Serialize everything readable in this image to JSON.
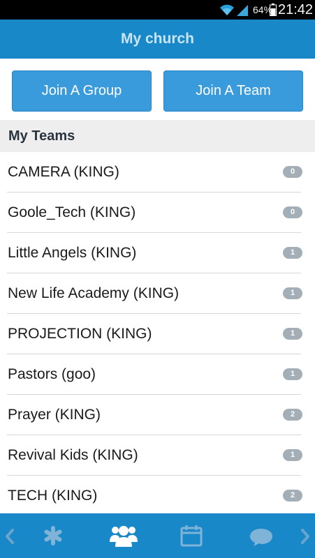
{
  "status_bar": {
    "battery": "64%",
    "time": "21:42",
    "icons": [
      "wifi-icon",
      "signal-icon",
      "battery-icon"
    ]
  },
  "header": {
    "title": "My church"
  },
  "actions": {
    "join_group": "Join A Group",
    "join_team": "Join A Team"
  },
  "section": {
    "title": "My Teams"
  },
  "teams": [
    {
      "name": "CAMERA (KING)",
      "count": "0"
    },
    {
      "name": "Goole_Tech (KING)",
      "count": "0"
    },
    {
      "name": "Little Angels (KING)",
      "count": "1"
    },
    {
      "name": "New Life Academy (KING)",
      "count": "1"
    },
    {
      "name": "PROJECTION (KING)",
      "count": "1"
    },
    {
      "name": "Pastors (goo)",
      "count": "1"
    },
    {
      "name": "Prayer (KING)",
      "count": "2"
    },
    {
      "name": "Revival Kids (KING)",
      "count": "1"
    },
    {
      "name": "TECH (KING)",
      "count": "2"
    }
  ],
  "bottom_nav": {
    "items": [
      "chevron-left-icon",
      "asterisk-icon",
      "people-icon",
      "calendar-icon",
      "chat-bubble-icon",
      "chevron-right-icon"
    ]
  },
  "colors": {
    "primary": "#1888c8",
    "button": "#3a9bdc",
    "badge": "#a4aeb6",
    "section_bg": "#eeeeee"
  }
}
